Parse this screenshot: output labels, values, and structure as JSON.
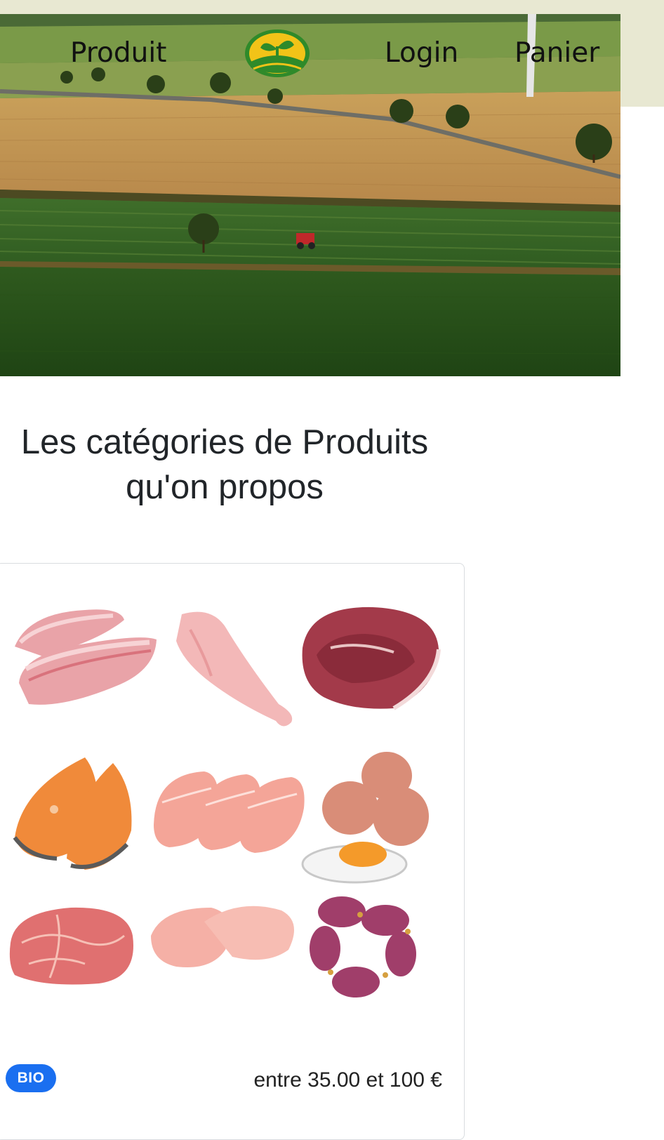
{
  "nav": {
    "product_label": "Produit",
    "login_label": "Login",
    "cart_label": "Panier",
    "logo_icon": "sprout-leaf-logo"
  },
  "section": {
    "heading_line1": "Les catégories de Produits",
    "heading_line2": "qu'on propos"
  },
  "card": {
    "image_subject": "meat-fish-eggs-assortment",
    "badge": "BIO",
    "price": "entre 35.00 et 100 €"
  },
  "colors": {
    "header_bg": "#e8e8d2",
    "badge_bg": "#1a6ff0",
    "logo_green": "#2f8a2a",
    "logo_yellow": "#f2c318"
  }
}
